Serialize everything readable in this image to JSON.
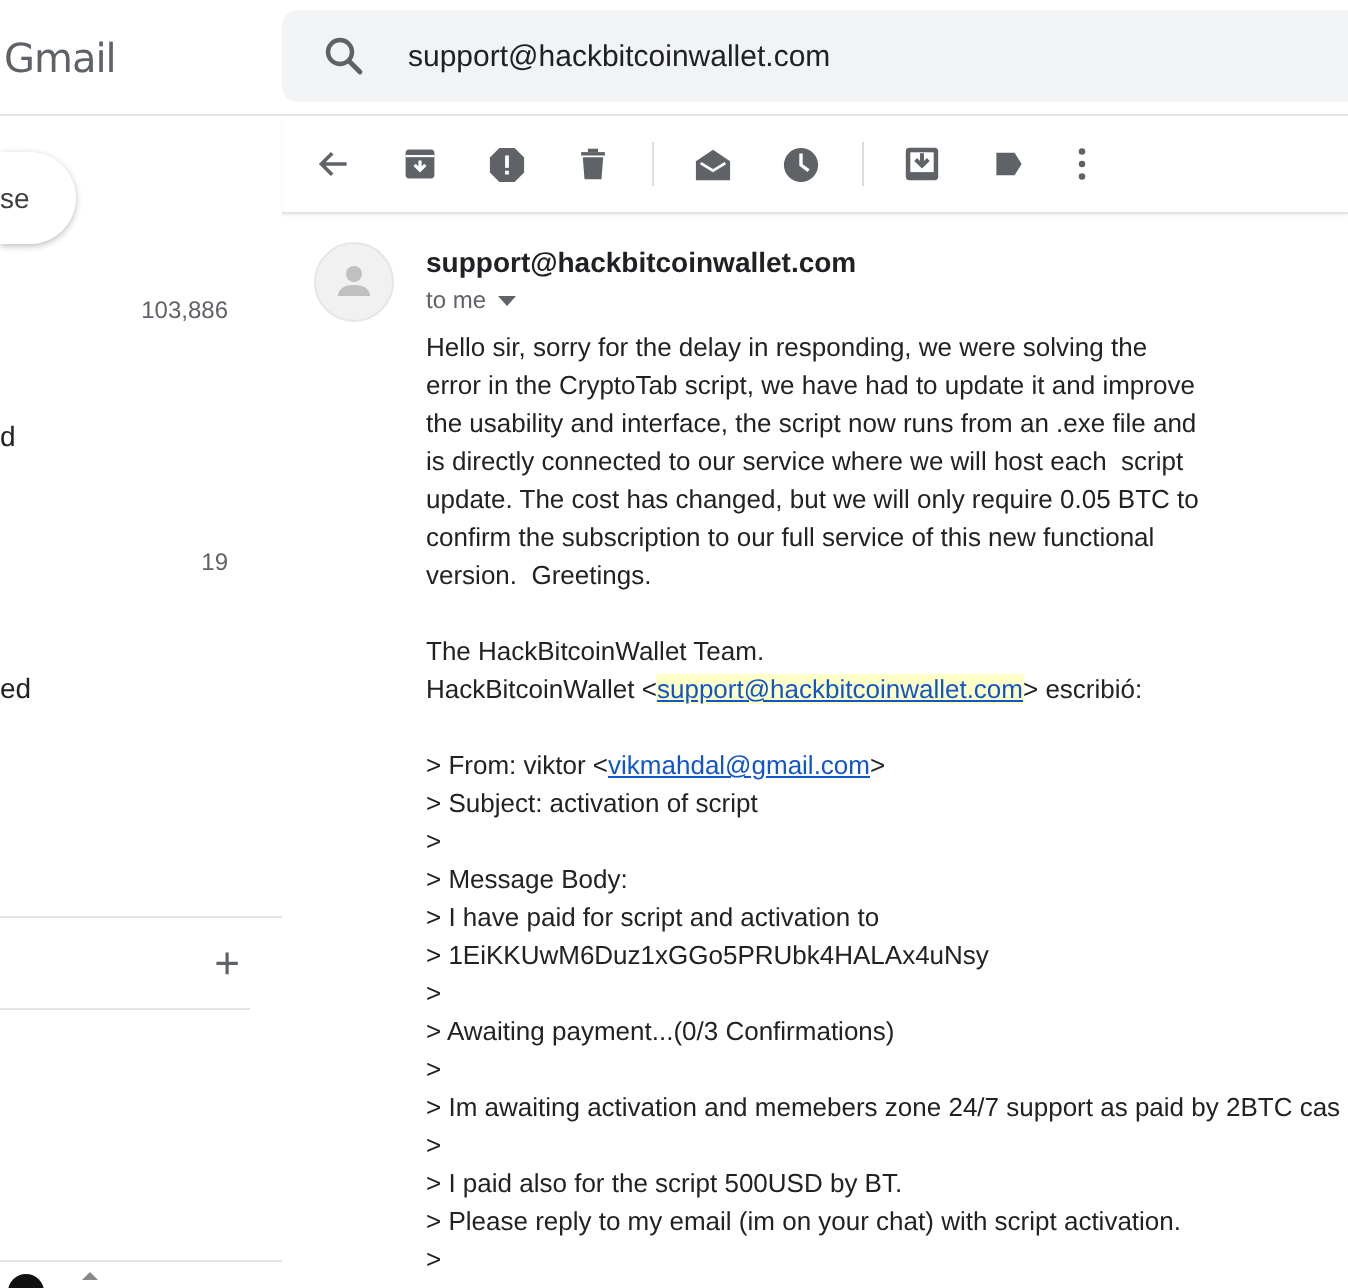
{
  "header": {
    "app_name": "Gmail",
    "search": {
      "value": "support@hackbitcoinwallet.com"
    }
  },
  "sidebar": {
    "compose_label": "se",
    "items": [
      {
        "count": "103,886"
      },
      {
        "label": "d"
      },
      {
        "count": "19"
      },
      {
        "label": "ed"
      }
    ],
    "add_label": "+"
  },
  "message": {
    "sender": "support@hackbitcoinwallet.com",
    "recipient": "to me",
    "body": [
      "Hello sir, sorry for the delay in responding, we were solving the",
      "error in the CryptoTab script, we have had to update it and improve",
      "the usability and interface, the script now runs from an .exe file and",
      "is directly connected to our service where we will host each  script",
      "update. The cost has changed, but we will only require 0.05 BTC to",
      "confirm the subscription to our full service of this new functional",
      "version.  Greetings."
    ],
    "signature": "The HackBitcoinWallet Team.",
    "attribution": {
      "prefix": "HackBitcoinWallet <",
      "link": "support@hackbitcoinwallet.com",
      "highlighted": true,
      "suffix": "> escribió:"
    },
    "quote": [
      {
        "kind": "link",
        "prefix": "> From: viktor <",
        "link": "vikmahdal@gmail.com",
        "highlighted": false,
        "suffix": ">"
      },
      {
        "kind": "text",
        "text": "> Subject: activation of script"
      },
      {
        "kind": "text",
        "text": ">"
      },
      {
        "kind": "text",
        "text": "> Message Body:"
      },
      {
        "kind": "text",
        "text": "> I have paid for script and activation to"
      },
      {
        "kind": "text",
        "text": "> 1EiKKUwM6Duz1xGGo5PRUbk4HALAx4uNsy"
      },
      {
        "kind": "text",
        "text": ">"
      },
      {
        "kind": "text",
        "text": "> Awaiting payment...(0/3 Confirmations)"
      },
      {
        "kind": "text",
        "text": ">"
      },
      {
        "kind": "text",
        "text": "> Im awaiting activation and memebers zone 24/7 support as paid by 2BTC cas"
      },
      {
        "kind": "text",
        "text": ">"
      },
      {
        "kind": "text",
        "text": "> I paid also for the script 500USD by BT."
      },
      {
        "kind": "text",
        "text": "> Please reply to my email (im on your chat) with script activation."
      },
      {
        "kind": "text",
        "text": ">"
      }
    ]
  }
}
